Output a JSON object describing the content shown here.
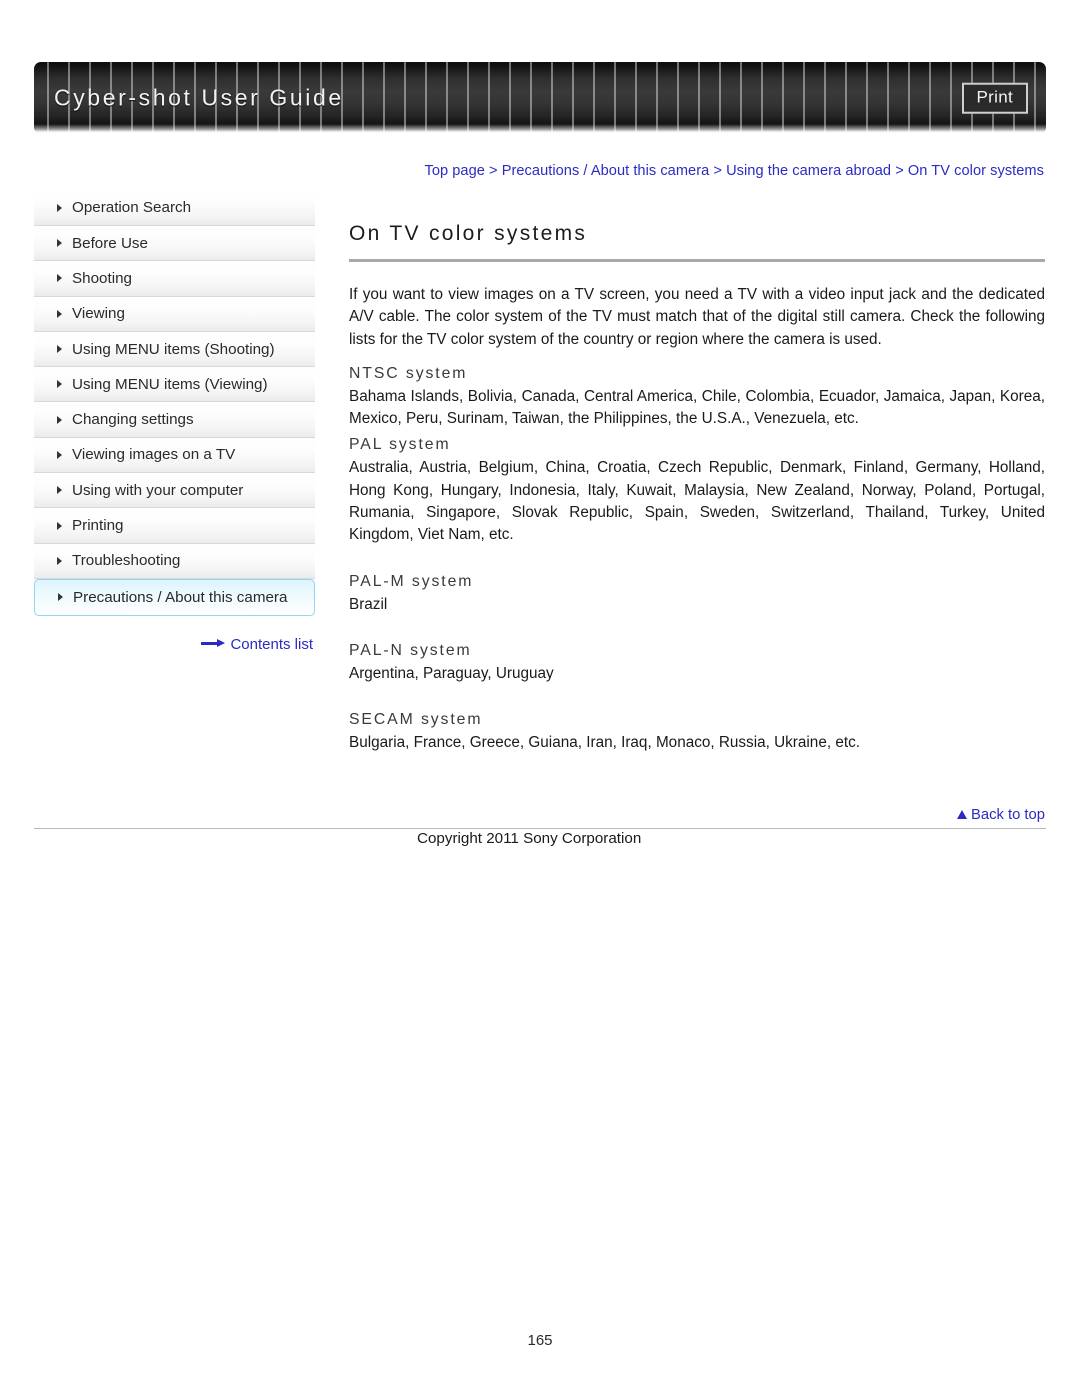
{
  "header": {
    "title": "Cyber-shot User Guide",
    "print_label": "Print"
  },
  "breadcrumb": {
    "text": "Top page > Precautions / About this camera > Using the camera abroad > On TV color systems"
  },
  "sidebar": {
    "items": [
      {
        "label": "Operation Search",
        "active": false
      },
      {
        "label": "Before Use",
        "active": false
      },
      {
        "label": "Shooting",
        "active": false
      },
      {
        "label": "Viewing",
        "active": false
      },
      {
        "label": "Using MENU items (Shooting)",
        "active": false
      },
      {
        "label": "Using MENU items (Viewing)",
        "active": false
      },
      {
        "label": "Changing settings",
        "active": false
      },
      {
        "label": "Viewing images on a TV",
        "active": false
      },
      {
        "label": "Using with your computer",
        "active": false
      },
      {
        "label": "Printing",
        "active": false
      },
      {
        "label": "Troubleshooting",
        "active": false
      },
      {
        "label": "Precautions / About this camera",
        "active": true
      }
    ],
    "contents_link": "Contents list"
  },
  "main": {
    "heading": "On TV color systems",
    "intro": "If you want to view images on a TV screen, you need a TV with a video input jack and the dedicated A/V cable. The color system of the TV must match that of the digital still camera. Check the following lists for the TV color system of the country or region where the camera is used.",
    "systems": [
      {
        "heading": "NTSC system",
        "body": "Bahama Islands, Bolivia, Canada, Central America, Chile, Colombia, Ecuador, Jamaica, Japan, Korea, Mexico, Peru, Surinam, Taiwan, the Philippines, the U.S.A., Venezuela, etc."
      },
      {
        "heading": "PAL system",
        "body": "Australia, Austria, Belgium, China, Croatia, Czech Republic, Denmark, Finland, Germany, Holland, Hong Kong, Hungary, Indonesia, Italy, Kuwait, Malaysia, New Zealand, Norway, Poland, Portugal, Rumania, Singapore, Slovak Republic, Spain, Sweden, Switzerland, Thailand, Turkey, United Kingdom, Viet Nam, etc."
      },
      {
        "heading": "PAL-M system",
        "body": "Brazil"
      },
      {
        "heading": "PAL-N system",
        "body": "Argentina, Paraguay, Uruguay"
      },
      {
        "heading": "SECAM system",
        "body": "Bulgaria, France, Greece, Guiana, Iran, Iraq, Monaco, Russia, Ukraine, etc."
      }
    ]
  },
  "footer": {
    "back_to_top": "Back to top",
    "copyright": "Copyright 2011 Sony Corporation",
    "page_number": "165"
  },
  "colors": {
    "link_blue": "#2b2bc4",
    "active_border": "#8fd8ee",
    "rule_gray": "#a8a8a8"
  }
}
